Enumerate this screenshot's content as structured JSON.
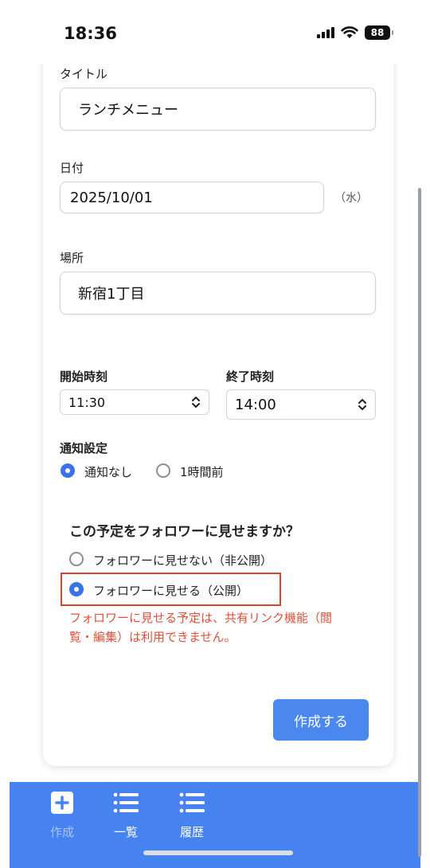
{
  "status_bar": {
    "time": "18:36",
    "battery": "88"
  },
  "form": {
    "title_label": "タイトル",
    "title_value": "ランチメニュー",
    "date_label": "日付",
    "date_value": "2025/10/01",
    "weekday": "（水）",
    "place_label": "場所",
    "place_value": "新宿1丁目",
    "start_label": "開始時刻",
    "start_value": "11:30",
    "end_label": "終了時刻",
    "end_value": "14:00",
    "notify_label": "通知設定",
    "notify_options": [
      "通知なし",
      "1時間前"
    ],
    "notify_selected": "通知なし",
    "visibility_question": "この予定をフォロワーに見せますか？",
    "visibility_options": [
      "フォロワーに見せない（非公開）",
      "フォロワーに見せる（公開）"
    ],
    "visibility_selected": "フォロワーに見せる（公開）",
    "warning_line1": "フォロワーに見せる予定は、共有リンク機能（閲",
    "warning_line2": "覧・編集）は利用できません。",
    "submit_label": "作成する"
  },
  "bottom_nav": {
    "items": [
      {
        "label": "作成",
        "icon": "plus-square-icon",
        "active": true
      },
      {
        "label": "一覧",
        "icon": "list-icon",
        "active": false
      },
      {
        "label": "履歴",
        "icon": "list-icon",
        "active": false
      }
    ]
  },
  "colors": {
    "accent": "#3b72e6",
    "button": "#4a87ef",
    "nav_bg": "#4682f0",
    "warning": "#e0503a",
    "highlight": "#d9452f"
  }
}
